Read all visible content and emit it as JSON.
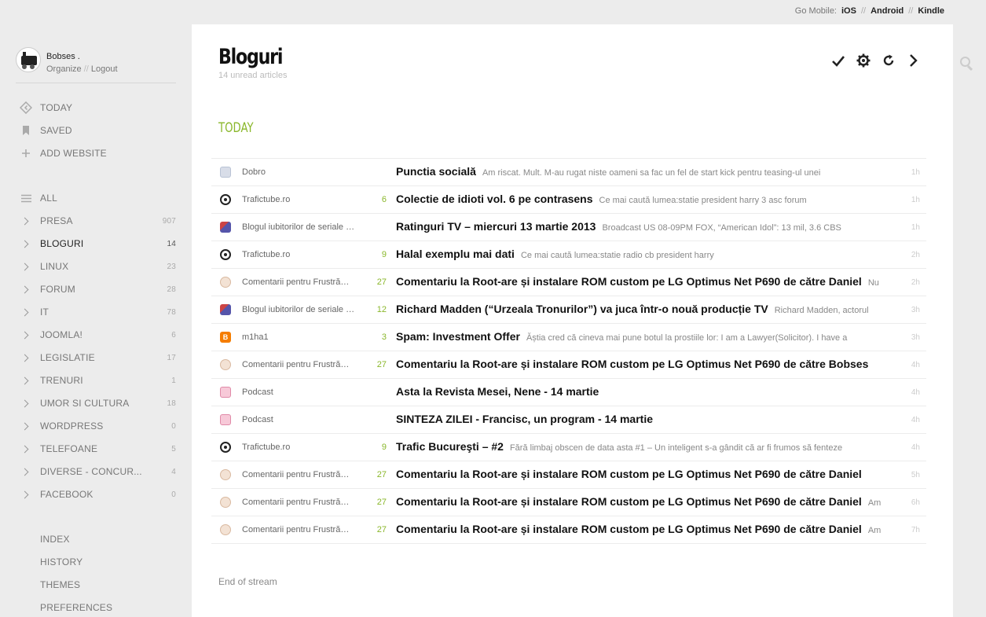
{
  "topbar": {
    "label": "Go Mobile:",
    "links": [
      "iOS",
      "Android",
      "Kindle"
    ],
    "sep": "//"
  },
  "user": {
    "name": "Bobses .",
    "organize": "Organize",
    "sep": "//",
    "logout": "Logout"
  },
  "nav_top": [
    {
      "label": "TODAY",
      "icon": "today-icon"
    },
    {
      "label": "SAVED",
      "icon": "bookmark-icon"
    },
    {
      "label": "ADD WEBSITE",
      "icon": "plus-icon"
    }
  ],
  "nav_all": {
    "label": "ALL",
    "icon": "list-icon"
  },
  "categories": [
    {
      "label": "PRESA",
      "count": "907"
    },
    {
      "label": "BLOGURI",
      "count": "14",
      "active": true
    },
    {
      "label": "LINUX",
      "count": "23"
    },
    {
      "label": "FORUM",
      "count": "28"
    },
    {
      "label": "IT",
      "count": "78"
    },
    {
      "label": "JOOMLA!",
      "count": "6"
    },
    {
      "label": "LEGISLATIE",
      "count": "17"
    },
    {
      "label": "TRENURI",
      "count": "1"
    },
    {
      "label": "UMOR SI CULTURA",
      "count": "18"
    },
    {
      "label": "WORDPRESS",
      "count": "0"
    },
    {
      "label": "TELEFOANE",
      "count": "5"
    },
    {
      "label": "DIVERSE - CONCUR...",
      "count": "4"
    },
    {
      "label": "FACEBOOK",
      "count": "0"
    }
  ],
  "bottom_links": [
    "INDEX",
    "HISTORY",
    "THEMES",
    "PREFERENCES"
  ],
  "main": {
    "title": "Bloguri",
    "unread": "14 unread articles",
    "section": "TODAY",
    "end": "End of stream"
  },
  "articles": [
    {
      "icon": "rss",
      "feed": "Dobro",
      "num": "",
      "title": "Punctia socială",
      "snippet": "Am riscat. Mult. M-au rugat niste oameni sa fac un fel de start kick pentru teasing-ul unei",
      "age": "1h"
    },
    {
      "icon": "tt",
      "feed": "Trafictube.ro",
      "num": "6",
      "title": "Colectie de idioti vol. 6 pe contrasens",
      "snippet": "Ce mai caută lumea:statie president harry 3 asc forum",
      "age": "1h"
    },
    {
      "icon": "bk",
      "feed": "Blogul iubitorilor de seriale …",
      "num": "",
      "title": "Ratinguri TV – miercuri 13 martie 2013",
      "snippet": "Broadcast US 08-09PM FOX, “American Idol”: 13 mil, 3.6 CBS",
      "age": "1h"
    },
    {
      "icon": "tt",
      "feed": "Trafictube.ro",
      "num": "9",
      "title": "Halal exemplu mai dati",
      "snippet": "Ce mai caută lumea:statie radio cb president harry",
      "age": "2h"
    },
    {
      "icon": "fc",
      "feed": "Comentarii pentru Frustră…",
      "num": "27",
      "title": "Comentariu la Root-are și instalare ROM custom pe LG Optimus Net P690 de către Daniel",
      "snippet": "Nu",
      "age": "2h"
    },
    {
      "icon": "bk",
      "feed": "Blogul iubitorilor de seriale …",
      "num": "12",
      "title": "Richard Madden (“Urzeala Tronurilor”) va juca într-o nouă producție TV",
      "snippet": "Richard Madden, actorul",
      "age": "3h"
    },
    {
      "icon": "bl",
      "feed": "m1ha1",
      "num": "3",
      "title": "Spam: Investment Offer",
      "snippet": "Ăștia cred că cineva mai pune botul la prostiile lor: I am a Lawyer(Solicitor). I have a",
      "age": "3h"
    },
    {
      "icon": "fc",
      "feed": "Comentarii pentru Frustră…",
      "num": "27",
      "title": "Comentariu la Root-are și instalare ROM custom pe LG Optimus Net P690 de către Bobses",
      "snippet": "",
      "age": "4h"
    },
    {
      "icon": "pc",
      "feed": "Podcast",
      "num": "",
      "title": "Asta la Revista Mesei, Nene - 14 martie",
      "snippet": "",
      "age": "4h"
    },
    {
      "icon": "pc",
      "feed": "Podcast",
      "num": "",
      "title": "SINTEZA ZILEI - Francisc, un program - 14 martie",
      "snippet": "",
      "age": "4h"
    },
    {
      "icon": "tt",
      "feed": "Trafictube.ro",
      "num": "9",
      "title": "Trafic Bucureşti – #2",
      "snippet": "Fără limbaj obscen de data asta #1 – Un inteligent s-a gândit că ar fi frumos să fenteze",
      "age": "4h"
    },
    {
      "icon": "fc",
      "feed": "Comentarii pentru Frustră…",
      "num": "27",
      "title": "Comentariu la Root-are și instalare ROM custom pe LG Optimus Net P690 de către Daniel",
      "snippet": "",
      "age": "5h"
    },
    {
      "icon": "fc",
      "feed": "Comentarii pentru Frustră…",
      "num": "27",
      "title": "Comentariu la Root-are și instalare ROM custom pe LG Optimus Net P690 de către Daniel",
      "snippet": "Am",
      "age": "6h"
    },
    {
      "icon": "fc",
      "feed": "Comentarii pentru Frustră…",
      "num": "27",
      "title": "Comentariu la Root-are și instalare ROM custom pe LG Optimus Net P690 de către Daniel",
      "snippet": "Am",
      "age": "7h"
    }
  ],
  "colors": {
    "accent": "#8ab72b",
    "background": "#ececec",
    "panel": "#ffffff"
  }
}
